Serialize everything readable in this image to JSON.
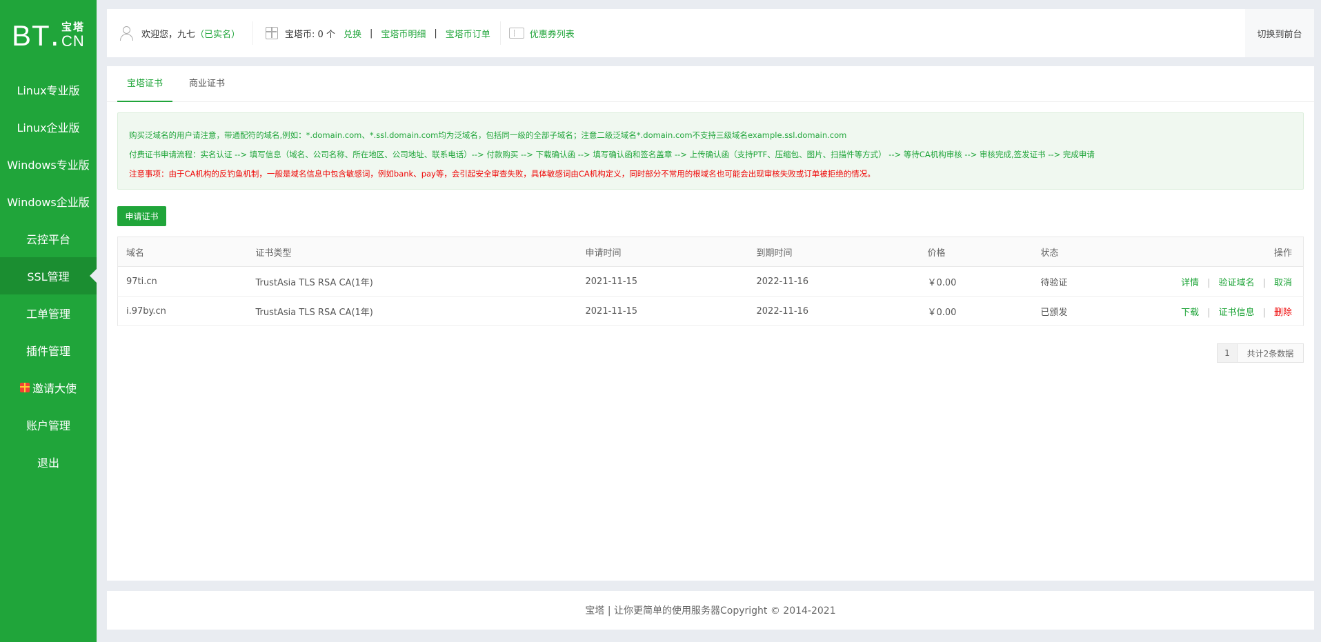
{
  "logo": {
    "text_bt": "BT",
    "text_dot": ".",
    "text_cn1": "宝塔",
    "text_cn2": "CN"
  },
  "sidebar": {
    "items": [
      {
        "label": "Linux专业版"
      },
      {
        "label": "Linux企业版"
      },
      {
        "label": "Windows专业版"
      },
      {
        "label": "Windows企业版"
      },
      {
        "label": "云控平台"
      },
      {
        "label": "SSL管理",
        "active": true
      },
      {
        "label": "工单管理"
      },
      {
        "label": "插件管理"
      },
      {
        "label": "邀请大使",
        "icon": "gift-icon"
      },
      {
        "label": "账户管理"
      },
      {
        "label": "退出"
      }
    ]
  },
  "header": {
    "welcome": "欢迎您，九七",
    "verified": "（已实名）",
    "coin_label": "宝塔币: 0 个",
    "exchange": "兑换",
    "coin_detail": "宝塔币明细",
    "coin_orders": "宝塔币订单",
    "coupon_list": "优惠券列表",
    "sep": "|",
    "switch_front": "切换到前台"
  },
  "tabs": [
    {
      "label": "宝塔证书",
      "active": true
    },
    {
      "label": "商业证书"
    }
  ],
  "notice": {
    "line1": "购买泛域名的用户请注意，带通配符的域名,例如：*.domain.com、*.ssl.domain.com均为泛域名，包括同一级的全部子域名；注意二级泛域名*.domain.com不支持三级域名example.ssl.domain.com",
    "line2": "付费证书申请流程：实名认证 --> 填写信息（域名、公司名称、所在地区、公司地址、联系电话）--> 付款购买 --> 下载确认函 --> 填写确认函和签名盖章 --> 上传确认函（支持PTF、压缩包、图片、扫描件等方式） --> 等待CA机构审核 --> 审核完成,签发证书 --> 完成申请",
    "line3": "注意事项：由于CA机构的反钓鱼机制，一般是域名信息中包含敏感词，例如bank、pay等，会引起安全审查失败，具体敏感词由CA机构定义，同时部分不常用的根域名也可能会出现审核失败或订单被拒绝的情况。"
  },
  "apply_button": "申请证书",
  "table": {
    "headers": [
      "域名",
      "证书类型",
      "申请时间",
      "到期时间",
      "价格",
      "状态",
      "操作"
    ],
    "rows": [
      {
        "domain": "97ti.cn",
        "type": "TrustAsia TLS RSA CA(1年)",
        "apply_date": "2021-11-15",
        "expire_date": "2022-11-16",
        "price": "￥0.00",
        "status": "待验证",
        "ops": [
          "详情",
          "验证域名",
          "取消"
        ]
      },
      {
        "domain": "i.97by.cn",
        "type": "TrustAsia TLS RSA CA(1年)",
        "apply_date": "2021-11-15",
        "expire_date": "2022-11-16",
        "price": "￥0.00",
        "status": "已颁发",
        "ops": [
          "下载",
          "证书信息",
          "删除"
        ]
      }
    ]
  },
  "pager": {
    "current": "1",
    "total": "共计2条数据"
  },
  "footer": "宝塔 | 让你更简单的使用服务器Copyright © 2014-2021",
  "colors": {
    "brand": "#20a53a",
    "danger": "#ef0808"
  }
}
